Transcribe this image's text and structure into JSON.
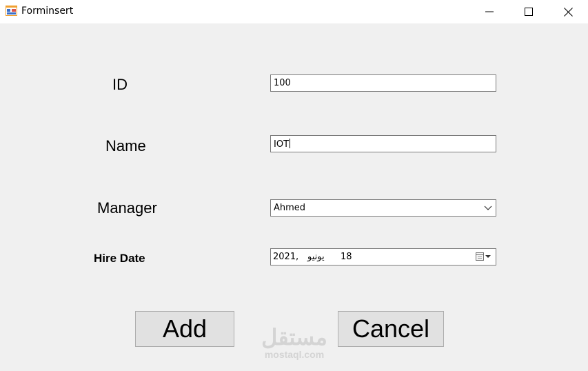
{
  "window": {
    "title": "Forminsert",
    "app_icon": "windows-form-icon",
    "controls": [
      "minimize-icon",
      "maximize-icon",
      "close-icon"
    ]
  },
  "form": {
    "id_label": "ID",
    "id_value": "100",
    "name_label": "Name",
    "name_value": "IOT",
    "manager_label": "Manager",
    "manager_value": "Ahmed",
    "hire_date_label": "Hire Date",
    "hire_date": {
      "year": "2021",
      "separator": ",",
      "month": "يونيو",
      "day": "18"
    }
  },
  "buttons": {
    "add_label": "Add",
    "cancel_label": "Cancel"
  },
  "watermark": {
    "arabic": "مستقل",
    "latin": "mostaql.com"
  },
  "colors": {
    "titlebar_bg": "#ffffff",
    "client_bg": "#f0f0f0",
    "button_bg": "#e1e1e1",
    "field_border": "#7a7a7a"
  }
}
